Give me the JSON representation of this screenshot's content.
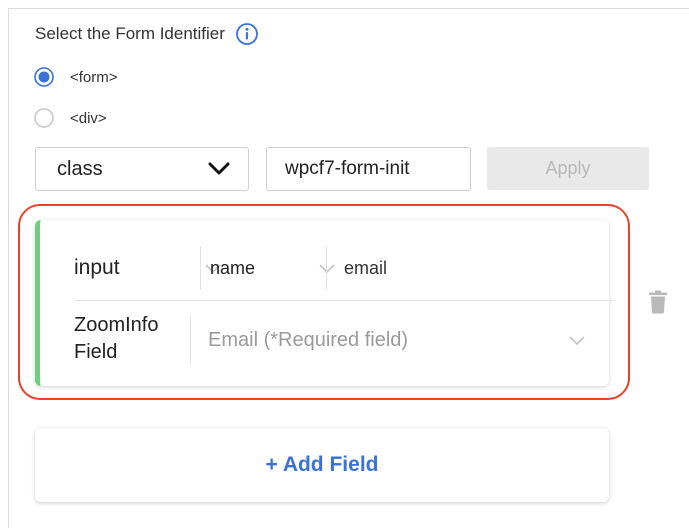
{
  "form_identifier": {
    "title": "Select the Form Identifier",
    "options": [
      {
        "label": "<form>",
        "selected": true
      },
      {
        "label": "<div>",
        "selected": false
      }
    ],
    "attribute_select": {
      "value": "class"
    },
    "attribute_value": "wpcf7-form-init",
    "apply_label": "Apply"
  },
  "mapping": {
    "tag": "input",
    "attribute": "name",
    "value": "email",
    "zoominfo_label_line1": "ZoomInfo",
    "zoominfo_label_line2": "Field",
    "zoominfo_placeholder": "Email (*Required field)"
  },
  "add_field_label": "+ Add Field",
  "colors": {
    "accent": "#3a72d8",
    "highlight": "#e8422a",
    "card_left_border": "#6dcf7f",
    "disabled_button": "#e9e9e9"
  },
  "icons": [
    "info-icon",
    "radio-selected-icon",
    "radio-empty-icon",
    "chevron-down-icon",
    "trash-icon"
  ]
}
